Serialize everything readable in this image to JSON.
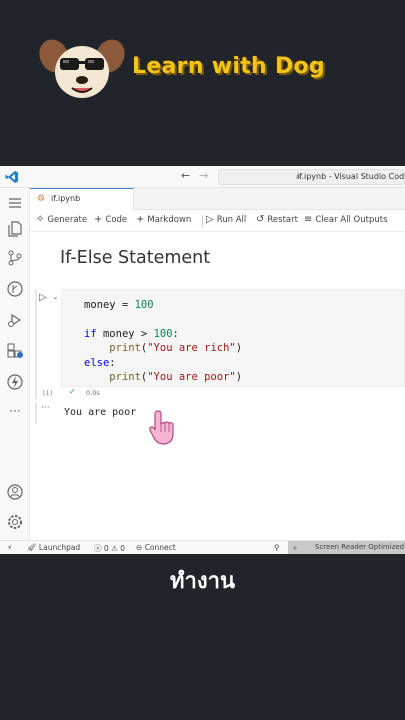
{
  "banner": {
    "brand_text": "Learn with Dog"
  },
  "window": {
    "title": "if.ipynb - Visual Studio Code",
    "tab_label": "if.ipynb",
    "toolbar": {
      "generate": "Generate",
      "code": "Code",
      "markdown": "Markdown",
      "run_all": "Run All",
      "restart": "Restart",
      "clear_outputs": "Clear All Outputs"
    },
    "markdown_title": "If-Else Statement",
    "cell": {
      "exec_count": "[1]",
      "exec_time": "0.0s",
      "output": "You are poor",
      "output_dots": "···"
    },
    "statusbar": {
      "launchpad": "Launchpad",
      "errors": "0",
      "warnings": "0",
      "connect": "Connect",
      "screen_reader": "Screen Reader Optimized"
    }
  },
  "subtitle": "ทำงาน"
}
